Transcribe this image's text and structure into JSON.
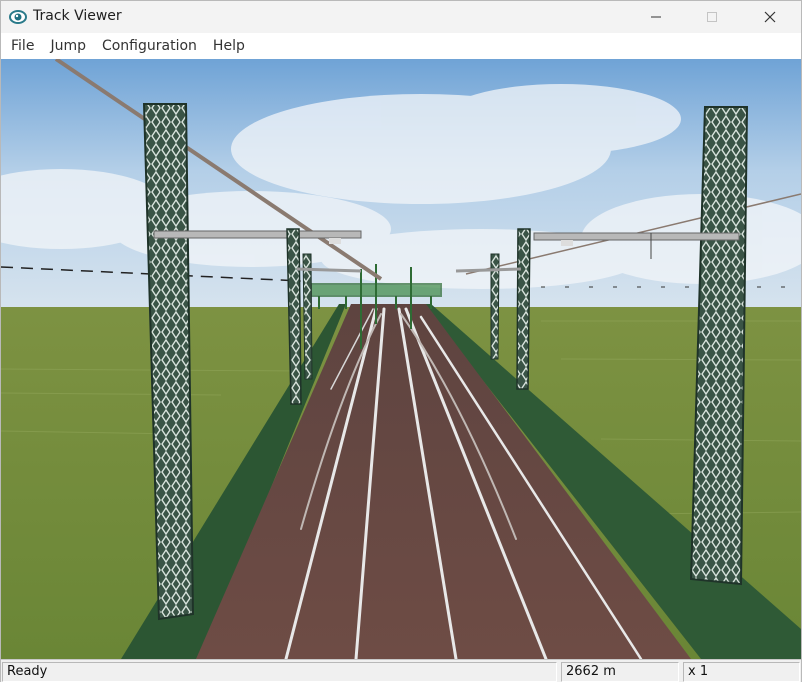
{
  "window": {
    "title": "Track Viewer",
    "icon": "eye-icon"
  },
  "menu": [
    {
      "label": "File"
    },
    {
      "label": "Jump"
    },
    {
      "label": "Configuration"
    },
    {
      "label": "Help"
    }
  ],
  "viewport": {
    "scene": "railway-track-3d-view",
    "colors": {
      "sky": "#9ec3e6",
      "grass": "#6e8a3a",
      "ballast": "#6b4a42",
      "mast": "#2f4a3e",
      "wall": "#2f5a36"
    }
  },
  "statusbar": {
    "status": "Ready",
    "distance": "2662 m",
    "speed": "x 1"
  }
}
